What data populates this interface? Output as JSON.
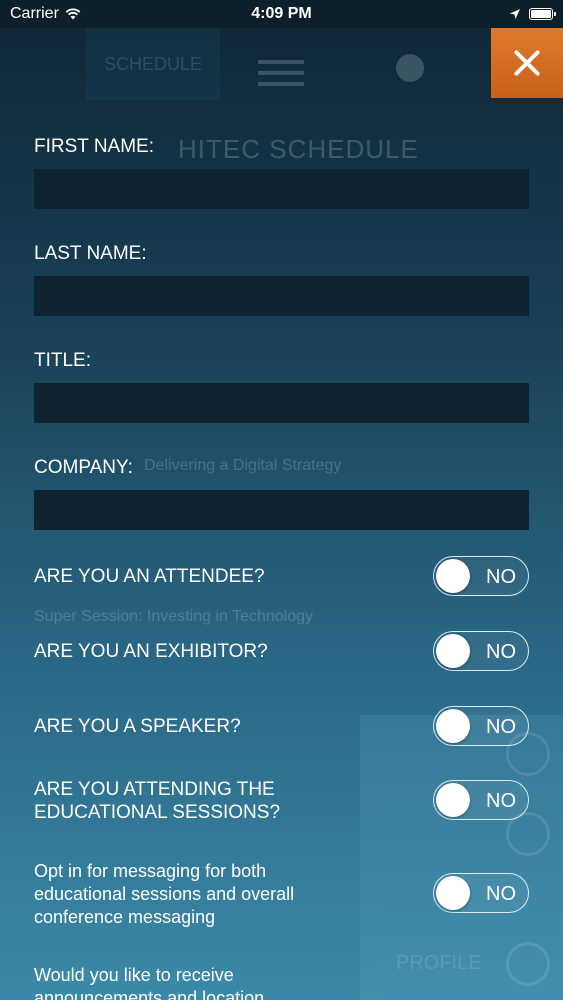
{
  "status_bar": {
    "carrier": "Carrier",
    "time": "4:09 PM"
  },
  "background": {
    "schedule_tab": "SCHEDULE",
    "header_title": "HITEC SCHEDULE",
    "line_1": "Delivering a Digital Strategy",
    "line_2": "Super Session: Investing in Technology",
    "profile_label": "PROFILE"
  },
  "form": {
    "first_name": {
      "label": "FIRST NAME:",
      "value": ""
    },
    "last_name": {
      "label": "LAST NAME:",
      "value": ""
    },
    "title": {
      "label": "TITLE:",
      "value": ""
    },
    "company": {
      "label": "COMPANY:",
      "value": ""
    }
  },
  "questions": [
    {
      "label": "ARE YOU AN ATTENDEE?",
      "toggle": "NO"
    },
    {
      "label": "ARE YOU AN EXHIBITOR?",
      "toggle": "NO"
    },
    {
      "label": "ARE YOU A SPEAKER?",
      "toggle": "NO"
    },
    {
      "label": "ARE YOU ATTENDING THE EDUCATIONAL SESSIONS?",
      "toggle": "NO"
    },
    {
      "label": "Opt in for messaging for both educational sessions and overall conference messaging",
      "toggle": "NO"
    },
    {
      "label": "Would you like to receive announcements and location",
      "toggle": ""
    }
  ],
  "colors": {
    "accent": "#d86e22",
    "input_bg": "#0f2230"
  }
}
